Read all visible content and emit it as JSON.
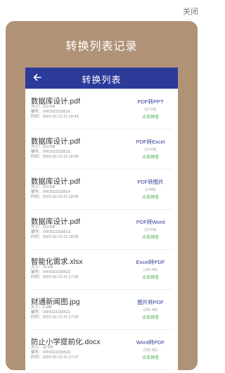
{
  "close_label": "关闭",
  "card_title": "转换列表记录",
  "header": {
    "title": "转换列表"
  },
  "labels": {
    "size": "大小：",
    "number": "编号：",
    "time": "时间："
  },
  "items": [
    {
      "name": "数据库设计.pdf",
      "size": "113 KB",
      "number": "VIP2022230516",
      "time": "2022-01-13 21:18:43",
      "type": "PDF转PPT",
      "result_size": "(27 KB)",
      "action": "点击预览"
    },
    {
      "name": "数据库设计.pdf",
      "size": "113 KB",
      "number": "VIP2022230515",
      "time": "2022-01-13 21:18:40",
      "type": "PDF转Excel",
      "result_size": "(13 KB)",
      "action": "点击预览"
    },
    {
      "name": "数据库设计.pdf",
      "size": "113 KB",
      "number": "VIP2022230514",
      "time": "2022-01-13 21:18:06",
      "type": "PDF转图片",
      "result_size": "(1 MB)",
      "action": "点击预览"
    },
    {
      "name": "数据库设计.pdf",
      "size": "113 KB",
      "number": "VIP2022230513",
      "time": "2022-01-13 21:18:05",
      "type": "PDF转Word",
      "result_size": "(22 KB)",
      "action": "点击预览"
    },
    {
      "name": "智能化需求.xlsx",
      "size": "14 KB",
      "number": "VIP2022230512",
      "time": "2022-01-13 21:17:45",
      "type": "Excel转PDF",
      "result_size": "(160 KB)",
      "action": "点击预览"
    },
    {
      "name": "财通新闻图.jpg",
      "size": "2 MB",
      "number": "VIP2022230511",
      "time": "2022-01-13 21:17:32",
      "type": "图片转PDF",
      "result_size": "(230 KB)",
      "action": "点击预览"
    },
    {
      "name": "防止小学提前化.docx",
      "size": "32 KB",
      "number": "VIP2022230510",
      "time": "2022-01-13 21:17:17",
      "type": "Word转PDF",
      "result_size": "(235 KB)",
      "action": "点击预览"
    }
  ]
}
